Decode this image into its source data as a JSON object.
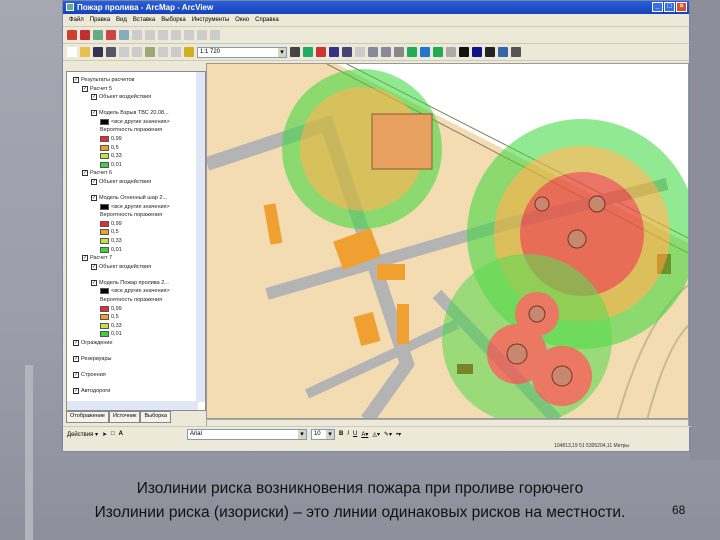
{
  "window": {
    "title": "Пожар пролива - ArcMap - ArcView",
    "controls": [
      "_",
      "□",
      "×"
    ]
  },
  "menu": [
    "Файл",
    "Правка",
    "Вид",
    "Вставка",
    "Выборка",
    "Инструменты",
    "Окно",
    "Справка"
  ],
  "toolbar": {
    "scale": "1:1 720"
  },
  "toc": {
    "items": [
      {
        "label": "Результаты расчетов",
        "level": 0,
        "type": "group"
      },
      {
        "label": "Расчет 5",
        "level": 1,
        "type": "group"
      },
      {
        "label": "Объект воздействия",
        "level": 2,
        "type": "layer"
      },
      {
        "label": "Модель Взрыв ТВС 20.08...",
        "level": 2,
        "type": "layer"
      },
      {
        "label": "<все другие значения>",
        "level": 3,
        "type": "swatch",
        "color": "#000000"
      },
      {
        "label": "Вероятность поражения",
        "level": 3,
        "type": "text"
      },
      {
        "label": "0,99",
        "level": 3,
        "type": "swatch",
        "color": "#e03030"
      },
      {
        "label": "0,5",
        "level": 3,
        "type": "swatch",
        "color": "#f0a030"
      },
      {
        "label": "0,33",
        "level": 3,
        "type": "swatch",
        "color": "#c8e040"
      },
      {
        "label": "0,01",
        "level": 3,
        "type": "swatch",
        "color": "#40d040"
      },
      {
        "label": "Расчет 6",
        "level": 1,
        "type": "group"
      },
      {
        "label": "Объект воздействия",
        "level": 2,
        "type": "layer"
      },
      {
        "label": "Модель Огненный шар 2...",
        "level": 2,
        "type": "layer"
      },
      {
        "label": "<все другие значения>",
        "level": 3,
        "type": "swatch",
        "color": "#000000"
      },
      {
        "label": "Вероятность поражения",
        "level": 3,
        "type": "text"
      },
      {
        "label": "0,99",
        "level": 3,
        "type": "swatch",
        "color": "#e03030"
      },
      {
        "label": "0,5",
        "level": 3,
        "type": "swatch",
        "color": "#f0a030"
      },
      {
        "label": "0,33",
        "level": 3,
        "type": "swatch",
        "color": "#c8e040"
      },
      {
        "label": "0,01",
        "level": 3,
        "type": "swatch",
        "color": "#40d040"
      },
      {
        "label": "Расчет 7",
        "level": 1,
        "type": "group"
      },
      {
        "label": "Объект воздействия",
        "level": 2,
        "type": "layer"
      },
      {
        "label": "Модель Пожар пролива 2...",
        "level": 2,
        "type": "layer"
      },
      {
        "label": "<все другие значения>",
        "level": 3,
        "type": "swatch",
        "color": "#000000"
      },
      {
        "label": "Вероятность поражения",
        "level": 3,
        "type": "text"
      },
      {
        "label": "0,99",
        "level": 3,
        "type": "swatch",
        "color": "#e03030"
      },
      {
        "label": "0,5",
        "level": 3,
        "type": "swatch",
        "color": "#f0a030"
      },
      {
        "label": "0,33",
        "level": 3,
        "type": "swatch",
        "color": "#c8e040"
      },
      {
        "label": "0,01",
        "level": 3,
        "type": "swatch",
        "color": "#40d040"
      },
      {
        "label": "Ограждение",
        "level": 0,
        "type": "layer"
      },
      {
        "label": "Резервуары",
        "level": 0,
        "type": "layer",
        "color": "#b03818"
      },
      {
        "label": "Строения",
        "level": 0,
        "type": "layer",
        "color": "#f0a030"
      },
      {
        "label": "Автодороги",
        "level": 0,
        "type": "layer"
      }
    ],
    "tabs": [
      "Отображение",
      "Источник",
      "Выборка"
    ]
  },
  "drawing": {
    "actions": "Действия ▾",
    "font": "Arial",
    "size": "10"
  },
  "status": {
    "coords": "104813,19 51 5305204,11 Метры"
  },
  "caption": {
    "line1": "Изолинии риска возникновения пожара при проливе горючего",
    "line2": "Изолинии риска (изориски) – это линии одинаковых рисков на местности."
  },
  "page_number": "68"
}
